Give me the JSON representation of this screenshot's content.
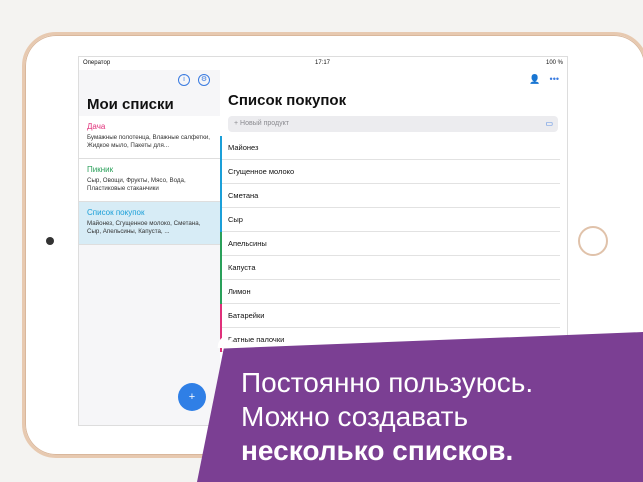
{
  "status": {
    "carrier": "Оператор",
    "time": "17:17",
    "battery": "100 %"
  },
  "sidebar": {
    "title": "Мои списки",
    "lists": [
      {
        "name": "Дача",
        "color": "#e0307a",
        "items": "Бумажные полотенца, Влажные салфетки, Жидкое мыло, Пакеты для..."
      },
      {
        "name": "Пикник",
        "color": "#2aa05a",
        "items": "Сыр, Овощи, Фрукты, Мясо, Вода, Пластиковые стаканчики"
      },
      {
        "name": "Список покупок",
        "color": "#1b9fd8",
        "items": "Майонез, Сгущенное молоко, Сметана, Сыр, Апельсины, Капуста, ..."
      }
    ]
  },
  "main": {
    "title": "Список покупок",
    "add_placeholder": "+ Новый продукт",
    "items": [
      {
        "label": "Майонез",
        "color": "#1b9fd8"
      },
      {
        "label": "Сгущенное молоко",
        "color": "#1b9fd8"
      },
      {
        "label": "Сметана",
        "color": "#1b9fd8"
      },
      {
        "label": "Сыр",
        "color": "#1b9fd8"
      },
      {
        "label": "Апельсины",
        "color": "#2aa05a"
      },
      {
        "label": "Капуста",
        "color": "#2aa05a"
      },
      {
        "label": "Лимон",
        "color": "#2aa05a"
      },
      {
        "label": "Батарейки",
        "color": "#e0307a"
      },
      {
        "label": "Ватные палочки",
        "color": "#e0307a"
      }
    ]
  },
  "banner": {
    "quote_mark": "“",
    "line1": "Постоянно пользуюсь.",
    "line2": "Можно создавать",
    "line3": "несколько списков."
  }
}
